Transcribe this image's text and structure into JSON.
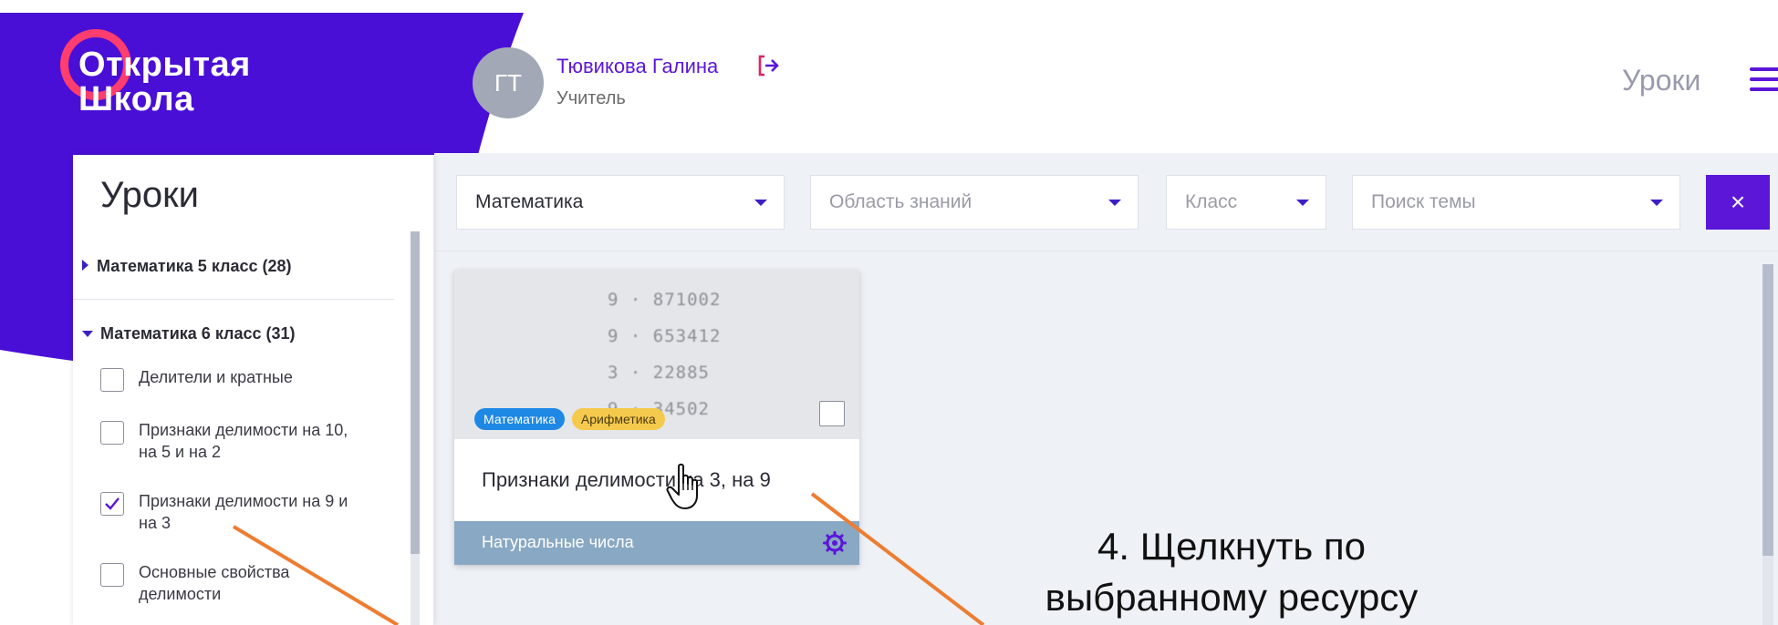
{
  "logo": {
    "line1": "Открытая",
    "line2": "Школа"
  },
  "header": {
    "avatar_initials": "ГТ",
    "user_name": "Тювикова Галина",
    "user_role": "Учитель",
    "logout_icon": "logout-icon",
    "nav_link": "Уроки",
    "menu_icon": "hamburger-menu-icon"
  },
  "sidebar": {
    "title": "Уроки",
    "groups": [
      {
        "label": "Математика 5 класс (28)",
        "expanded": false
      },
      {
        "label": "Математика 6 класс (31)",
        "expanded": true
      }
    ],
    "topics": [
      {
        "label_lines": [
          "Делители и кратные"
        ],
        "checked": false
      },
      {
        "label_lines": [
          "Признаки делимости на 10,",
          "на 5 и на 2"
        ],
        "checked": false
      },
      {
        "label_lines": [
          "Признаки делимости на 9 и",
          "на 3"
        ],
        "checked": true
      },
      {
        "label_lines": [
          "Основные свойства",
          "делимости"
        ],
        "checked": false
      }
    ]
  },
  "filters": {
    "subject": {
      "value": "Математика"
    },
    "area": {
      "placeholder": "Область знаний"
    },
    "grade": {
      "placeholder": "Класс"
    },
    "topic": {
      "placeholder": "Поиск темы"
    },
    "clear_label": "×"
  },
  "card": {
    "thumb_lines": [
      "9 · 871002",
      "9 · 653412",
      "3 · 22885",
      "9 · 34502"
    ],
    "tags": [
      "Математика",
      "Арифметика"
    ],
    "title": "Признаки делимости на 3, на 9",
    "footer_label": "Натуральные числа",
    "footer_icon": "gear-icon",
    "selected": false
  },
  "annotation": {
    "line1": "4. Щелкнуть по",
    "line2": "выбранному ресурсу"
  },
  "colors": {
    "brand_purple": "#4a0fd6",
    "accent_pink": "#ff3d6e",
    "arrow_orange": "#ed7d31",
    "card_footer": "#88a8c3"
  }
}
